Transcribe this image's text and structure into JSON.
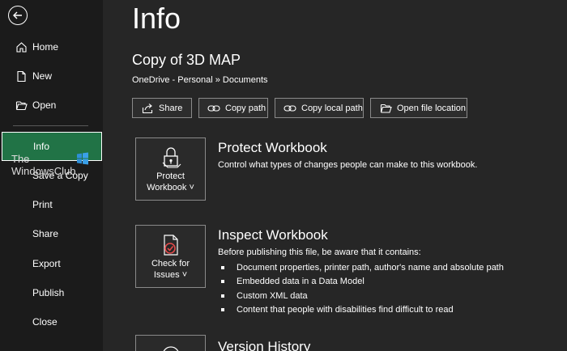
{
  "sidebar": {
    "items": [
      {
        "label": "Home"
      },
      {
        "label": "New"
      },
      {
        "label": "Open"
      },
      {
        "label": "Info"
      },
      {
        "label": "Save a Copy"
      },
      {
        "label": "Print"
      },
      {
        "label": "Share"
      },
      {
        "label": "Export"
      },
      {
        "label": "Publish"
      },
      {
        "label": "Close"
      }
    ]
  },
  "watermark": {
    "line1": "The",
    "line2": "WindowsClub"
  },
  "page": {
    "title": "Info",
    "doc_title": "Copy of 3D MAP",
    "breadcrumb": "OneDrive - Personal » Documents"
  },
  "actions": [
    {
      "label": "Share"
    },
    {
      "label": "Copy path"
    },
    {
      "label": "Copy local path"
    },
    {
      "label": "Open file location"
    }
  ],
  "sections": {
    "protect": {
      "tile_line1": "Protect",
      "tile_line2": "Workbook ˅",
      "title": "Protect Workbook",
      "desc": "Control what types of changes people can make to this workbook."
    },
    "inspect": {
      "tile_line1": "Check for",
      "tile_line2": "Issues ˅",
      "title": "Inspect Workbook",
      "desc": "Before publishing this file, be aware that it contains:",
      "bullets": [
        "Document properties, printer path, author's name and absolute path",
        "Embedded data in a Data Model",
        "Custom XML data",
        "Content that people with disabilities find difficult to read"
      ]
    },
    "version": {
      "title": "Version History"
    }
  },
  "colors": {
    "accent": "#217346",
    "sidebar_bg": "#1b1b1b",
    "main_bg": "#262626"
  }
}
